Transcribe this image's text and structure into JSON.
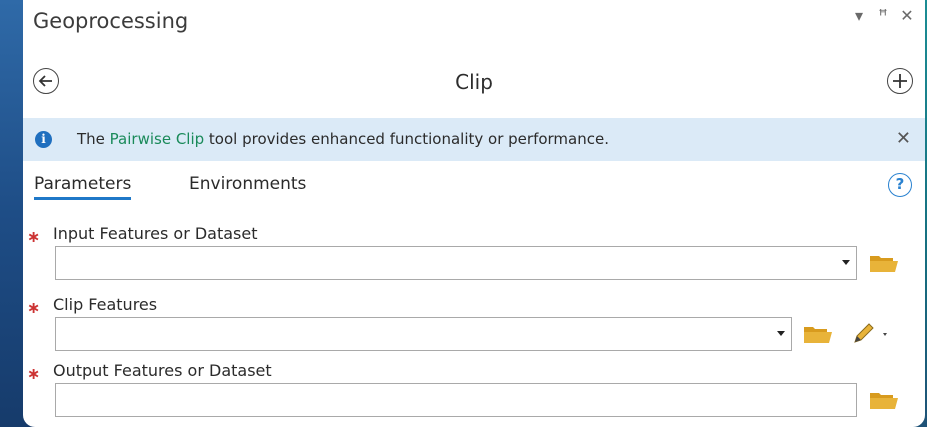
{
  "window": {
    "title": "Geoprocessing",
    "controls": [
      "▾",
      "ꟸ",
      "✕"
    ]
  },
  "tool": {
    "title": "Clip"
  },
  "info": {
    "prefix": "The ",
    "link": "Pairwise Clip",
    "suffix": " tool provides enhanced functionality or performance.",
    "close": "✕"
  },
  "tabs": {
    "parameters": "Parameters",
    "environments": "Environments"
  },
  "help": "?",
  "parameters": [
    {
      "label": "Input Features or Dataset",
      "required_mark": "∗",
      "value": ""
    },
    {
      "label": "Clip Features",
      "required_mark": "∗",
      "value": ""
    },
    {
      "label": "Output Features or Dataset",
      "required_mark": "∗",
      "value": ""
    }
  ],
  "colors": {
    "accent": "#1f78c8",
    "required": "#cc3333",
    "link": "#1a8a5a",
    "infobar": "#dbeaf7",
    "folder": "#e8b339"
  },
  "icons": [
    "back-icon",
    "add-icon",
    "info-icon",
    "help-icon",
    "folder-icon",
    "pencil-icon",
    "dropdown-arrow-icon"
  ]
}
